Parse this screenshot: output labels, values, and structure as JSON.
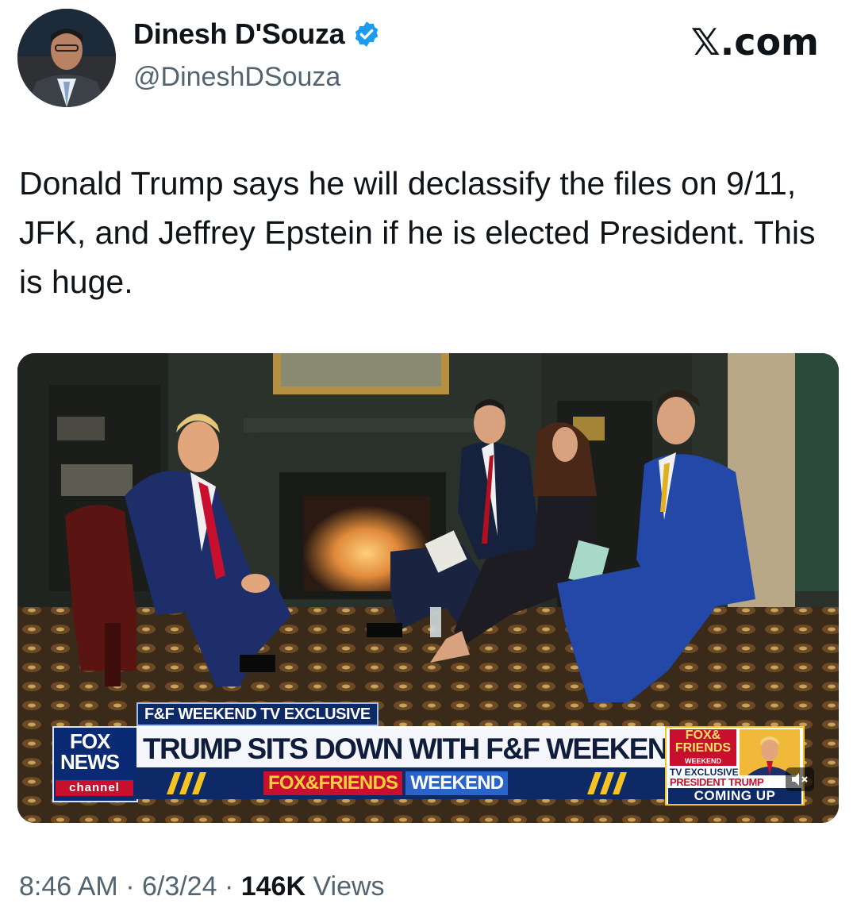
{
  "author": {
    "name": "Dinesh D'Souza",
    "handle": "@DineshDSouza",
    "verified": true,
    "avatar": "profile-photo"
  },
  "source_label": "𝕏.com",
  "tweet": {
    "text": "Donald Trump says he will declassify the files on 9/11, JFK, and Jeffrey Epstein if he is elected President. This is huge."
  },
  "media": {
    "type": "video-still",
    "exclusive_tag": "F&F WEEKEND TV EXCLUSIVE",
    "headline": "TRUMP SITS DOWN WITH F&F WEEKEND",
    "network_logo": {
      "line1": "FOX",
      "line2": "NEWS",
      "line3": "channel"
    },
    "ticker": {
      "brand_left": "FOX&FRIENDS",
      "brand_right": "WEEKEND"
    },
    "promo": {
      "logo_top": "FOX&",
      "logo_mid": "FRIENDS",
      "logo_sub": "WEEKEND",
      "line1": "TV EXCLUSIVE",
      "line2": "PRESIDENT TRUMP",
      "line3": "COMING UP"
    },
    "mute_icon": "speaker-muted-icon",
    "colors": {
      "fox_blue": "#0d2a66",
      "fox_red": "#c8102e",
      "fox_yellow": "#f5c423"
    }
  },
  "meta": {
    "time": "8:46 AM",
    "sep1": " · ",
    "date": "6/3/24",
    "sep2": " · ",
    "views_count": "146K",
    "views_label": " Views"
  },
  "colors": {
    "text": "#0f1419",
    "secondary": "#536471",
    "verified": "#1d9bf0"
  }
}
